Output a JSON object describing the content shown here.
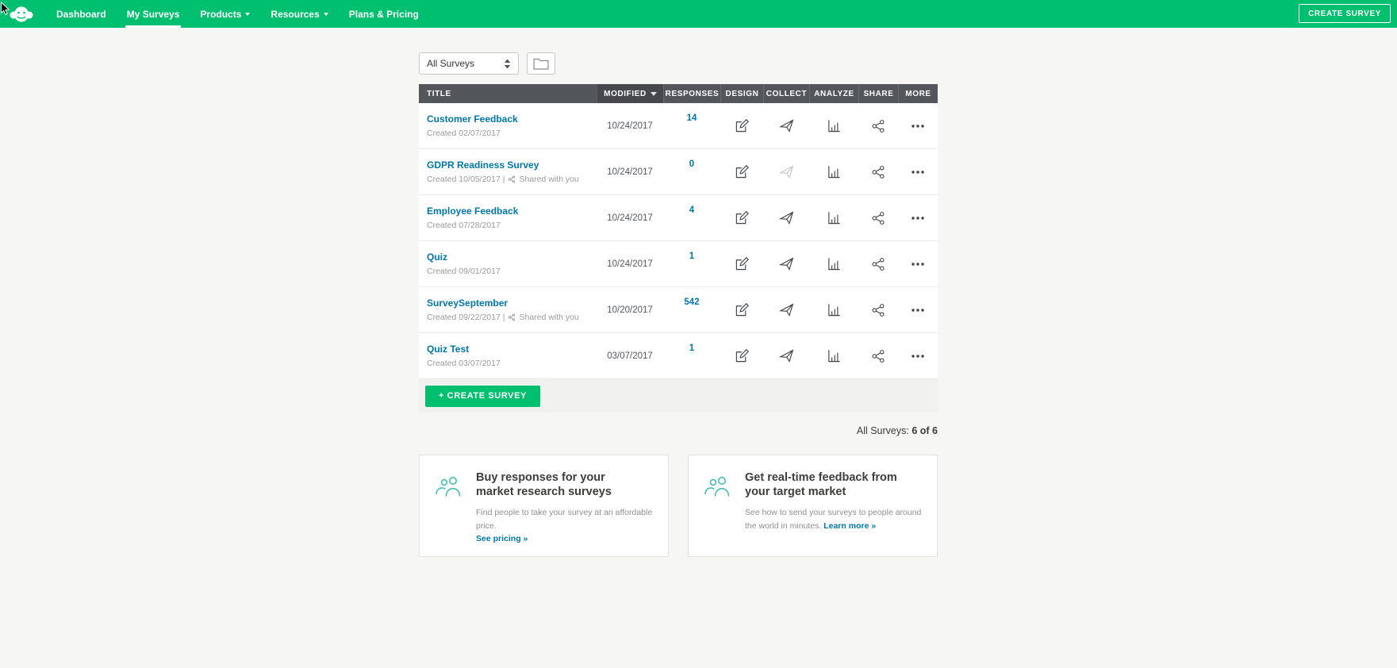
{
  "colors": {
    "brand_green": "#00BF6F",
    "link_blue": "#0077A8",
    "table_header_gray": "#53575C",
    "promo_teal": "#45BFB3"
  },
  "nav": {
    "items": [
      {
        "label": "Dashboard"
      },
      {
        "label": "My Surveys"
      },
      {
        "label": "Products"
      },
      {
        "label": "Resources"
      },
      {
        "label": "Plans & Pricing"
      }
    ],
    "create_button": "CREATE SURVEY"
  },
  "filters": {
    "selected": "All Surveys"
  },
  "table": {
    "headers": [
      "TITLE",
      "MODIFIED",
      "RESPONSES",
      "DESIGN",
      "COLLECT",
      "ANALYZE",
      "SHARE",
      "MORE"
    ],
    "rows": [
      {
        "title": "Customer Feedback",
        "created": "Created 02/07/2017",
        "modified": "10/24/2017",
        "responses": "14"
      },
      {
        "title": "GDPR Readiness Survey",
        "created": "Created 10/05/2017 |",
        "shared_label": "Shared with you",
        "modified": "10/24/2017",
        "responses": "0"
      },
      {
        "title": "Employee Feedback",
        "created": "Created 07/28/2017",
        "modified": "10/24/2017",
        "responses": "4"
      },
      {
        "title": "Quiz",
        "created": "Created 09/01/2017",
        "modified": "10/24/2017",
        "responses": "1"
      },
      {
        "title": "SurveySeptember",
        "created": "Created 09/22/2017 |",
        "shared_label": "Shared with you",
        "modified": "10/20/2017",
        "responses": "542"
      },
      {
        "title": "Quiz Test",
        "created": "Created 03/07/2017",
        "modified": "03/07/2017",
        "responses": "1"
      }
    ],
    "footer_button": "+ CREATE SURVEY",
    "summary_label": "All Surveys:",
    "summary_count": "6 of 6"
  },
  "promos": [
    {
      "title": "Buy responses for your market research surveys",
      "desc": "Find people to take your survey at an affordable price.",
      "link": "See pricing »"
    },
    {
      "title": "Get real-time feedback from your target market",
      "desc": "See how to send your surveys to people around the world in minutes.",
      "link": "Learn more »"
    }
  ]
}
